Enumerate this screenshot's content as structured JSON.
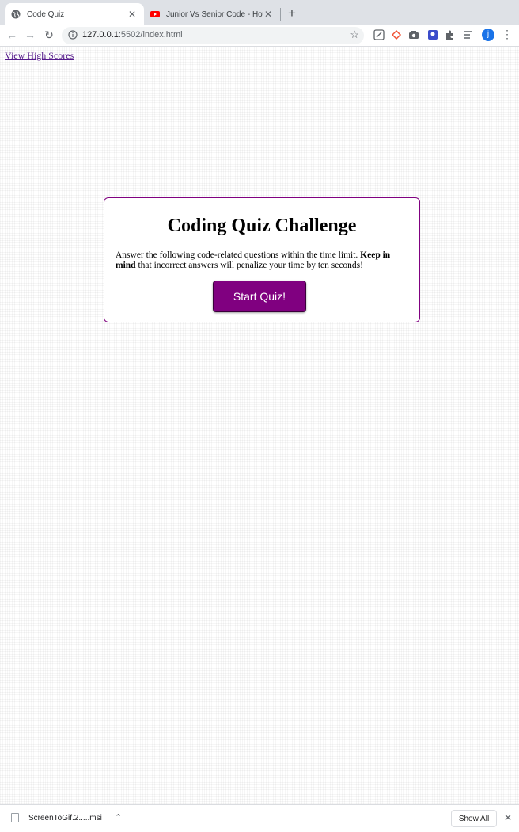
{
  "browser": {
    "tabs": [
      {
        "title": "Code Quiz",
        "icon": "globe-icon",
        "active": true
      },
      {
        "title": "Junior Vs Senior Code - How T",
        "icon": "youtube-icon",
        "active": false
      }
    ],
    "tab_close": "✕",
    "new_tab": "+",
    "nav": {
      "back": "←",
      "forward": "→",
      "reload": "↻"
    },
    "url_host": "127.0.0.1",
    "url_rest": ":5502/index.html",
    "bookmark_star": "☆",
    "profile_initial": "j",
    "menu": "⋮",
    "colors": {
      "tab_strip": "#dee1e6",
      "omnibox": "#f1f3f4",
      "avatar": "#1a73e8",
      "youtube": "#ff0000"
    }
  },
  "page": {
    "high_scores_link": "View High Scores",
    "card": {
      "title": "Coding Quiz Challenge",
      "description_before": "Answer the following code-related questions within the time limit. ",
      "description_bold": "Keep in mind",
      "description_after": " that incorrect answers will penalize your time by ten seconds!",
      "start_button": "Start Quiz!"
    },
    "colors": {
      "accent": "#800080",
      "link": "#551a8b"
    }
  },
  "downloads": {
    "file_name": "ScreenToGif.2.....msi",
    "caret": "⌃",
    "show_all": "Show All",
    "close": "✕"
  }
}
